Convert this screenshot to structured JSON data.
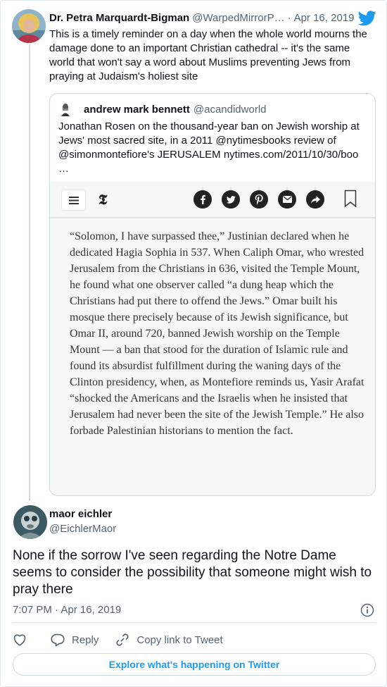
{
  "parent_tweet": {
    "author_name": "Dr. Petra Marquardt-Bigman",
    "author_handle": "@WarpedMirrorP…",
    "separator": "·",
    "date": "Apr 16, 2019",
    "text": "This is a timely reminder on a day when the whole world mourns the damage done to an important Christian cathedral -- it's the same world that won't say a word about Muslims preventing Jews from praying at Judaism's holiest site"
  },
  "quoted_tweet": {
    "author_name": "andrew mark bennett",
    "author_handle": "@acandidworld",
    "text": "Jonathan Rosen on the thousand-year ban on Jewish worship at Jews' most sacred site, in a 2011 @nytimesbooks review of @simonmontefiore's JERUSALEM nytimes.com/2011/10/30/boo",
    "ellipsis": "…",
    "media": {
      "logo": "𝕿",
      "article_text": "“Solomon, I have surpassed thee,” Justinian declared when he dedicated Hagia Sophia in 537. When Caliph Omar, who wrested Jerusalem from the Christians in 636, visited the Temple Mount, he found what one observer called “a dung heap which the Christians had put there to offend the Jews.” Omar built his mosque there precisely because of its Jewish significance, but Omar II, around 720, banned Jewish worship on the Temple Mount — a ban that stood for the duration of Islamic rule and found its absurdist fulfillment during the waning days of the Clinton presidency, when, as Montefiore reminds us, Yasir Arafat “shocked the Americans and the Israelis when he insisted that Jerusalem had never been the site of the Jewish Temple.” He also forbade Palestinian historians to mention the fact.",
      "share_icons": [
        "facebook-icon",
        "twitter-icon",
        "pinterest-icon",
        "email-icon",
        "share-icon"
      ]
    }
  },
  "main_tweet": {
    "author_name": "maor eichler",
    "author_handle": "@EichlerMaor",
    "text": "None if the sorrow I've seen regarding the Notre Dame seems to consider the possibility that someone might wish to pray there",
    "timestamp": "7:07 PM · Apr 16, 2019"
  },
  "actions": {
    "reply_label": "Reply",
    "copy_link_label": "Copy link to Tweet"
  },
  "explore_label": "Explore what's happening on Twitter",
  "colors": {
    "twitter_blue": "#1d9bf0",
    "text_primary": "#0f1419",
    "text_secondary": "#536471",
    "border": "#cfd9de"
  }
}
